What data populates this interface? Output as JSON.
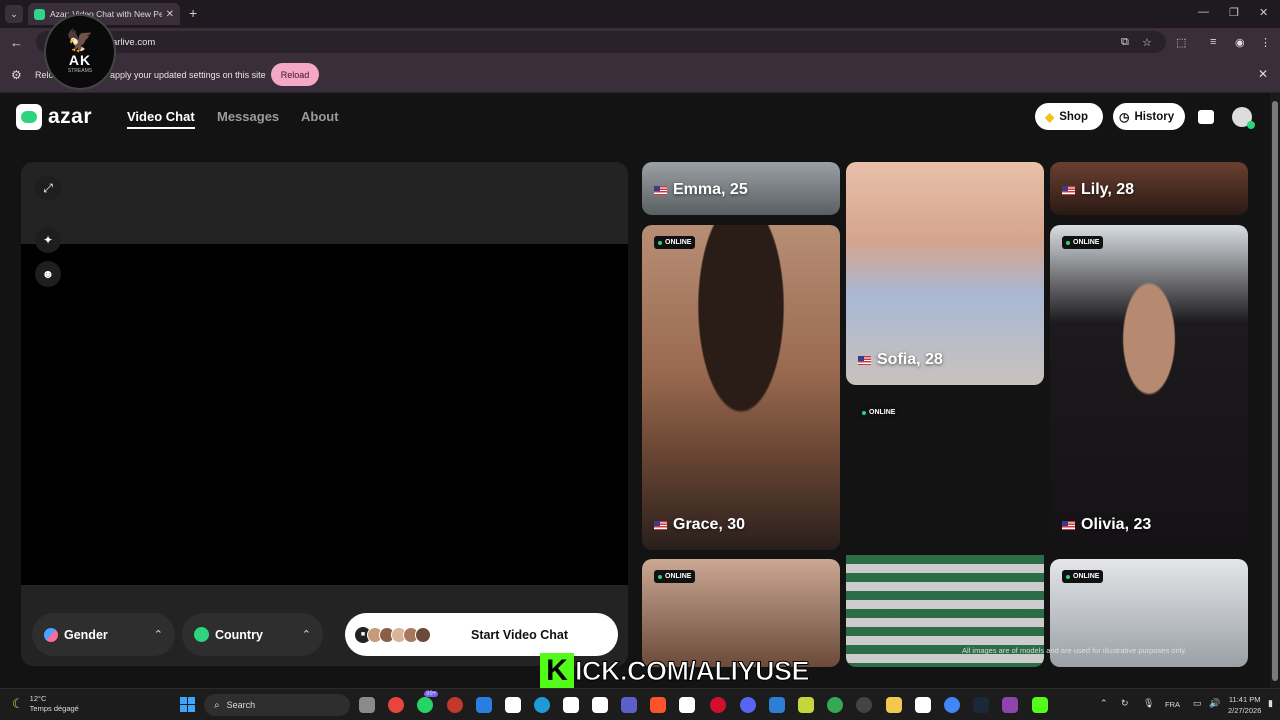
{
  "browser": {
    "tab_title": "Azar: Video Chat with New Peo",
    "tab_close": "✕",
    "new_tab": "+",
    "url": "arlive.com",
    "infobar": {
      "message_start": "Relo",
      "message_end": "apply your updated settings on this site",
      "reload_label": "Reload"
    }
  },
  "overlay_logo": {
    "text": "AK",
    "sub": "STREAMS"
  },
  "site": {
    "brand": "azar",
    "nav": [
      {
        "label": "Video Chat",
        "active": true
      },
      {
        "label": "Messages",
        "active": false
      },
      {
        "label": "About",
        "active": false
      }
    ],
    "shop_label": "Shop",
    "history_label": "History",
    "gender_label": "Gender",
    "country_label": "Country",
    "start_label": "Start Video Chat",
    "online_label": "ONLINE",
    "disclaimer": "All images are of models and are used for illustrative purposes only.",
    "profiles": [
      {
        "name": "Emma, 25",
        "online": false
      },
      {
        "name": "Sofia, 28",
        "online": false
      },
      {
        "name": "Lily, 28",
        "online": false
      },
      {
        "name": "Grace, 30",
        "online": true
      },
      {
        "name": "Olivia, 23",
        "online": true
      },
      {
        "name": "",
        "online": true
      },
      {
        "name": "",
        "online": true
      },
      {
        "name": "",
        "online": true
      }
    ]
  },
  "stream_overlay": {
    "k": "K",
    "text": "ICK.COM/ALIYUSE"
  },
  "taskbar": {
    "weather_temp": "12°C",
    "weather_desc": "Temps dégagé",
    "search_placeholder": "Search",
    "badge": "99+",
    "lang": "FRA",
    "time": "11:41 PM",
    "date": "2/27/2026"
  }
}
